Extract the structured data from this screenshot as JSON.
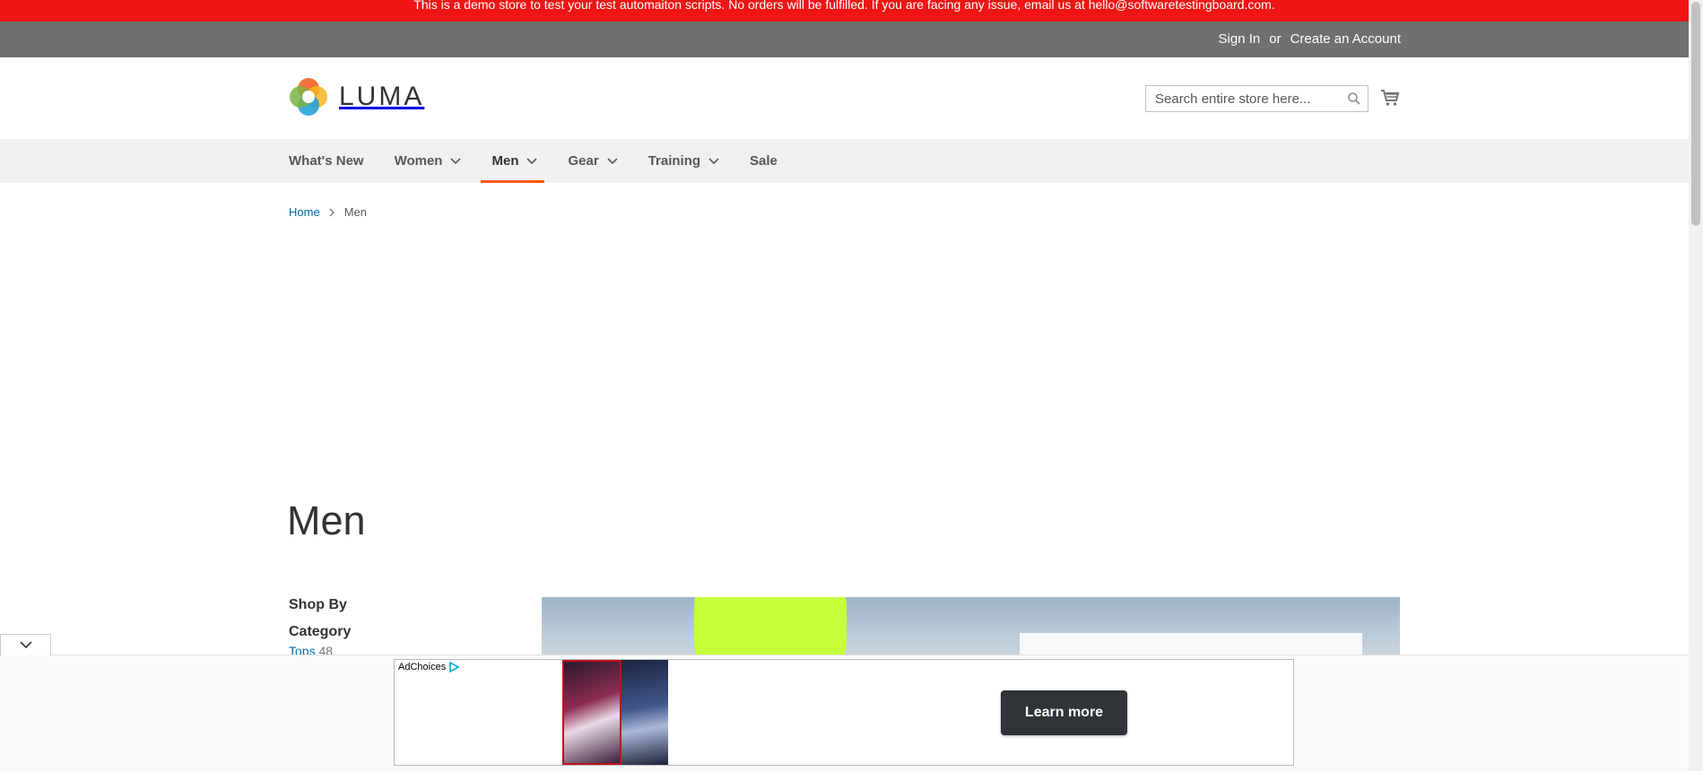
{
  "notice": {
    "text": "This is a demo store to test your test automaiton scripts. No orders will be fulfilled. If you are facing any issue, email us at hello@softwaretestingboard.com."
  },
  "account": {
    "sign_in": "Sign In",
    "or": "or",
    "create_account": "Create an Account"
  },
  "logo": {
    "text": "LUMA"
  },
  "search": {
    "placeholder": "Search entire store here..."
  },
  "nav": {
    "items": [
      {
        "label": "What's New"
      },
      {
        "label": "Women"
      },
      {
        "label": "Men"
      },
      {
        "label": "Gear"
      },
      {
        "label": "Training"
      },
      {
        "label": "Sale"
      }
    ],
    "active_color": "#ff5501"
  },
  "breadcrumb": {
    "home": "Home",
    "current": "Men"
  },
  "page": {
    "title": "Men"
  },
  "sidebar": {
    "shop_by": "Shop By",
    "category": "Category",
    "items": [
      {
        "label": "Tops",
        "count": "48"
      }
    ]
  },
  "ad": {
    "adchoices": "AdChoices",
    "cta": "Learn more"
  },
  "colors": {
    "notice_bg": "#ef1515",
    "topbar_bg": "#6e716e",
    "link": "#006bb4"
  }
}
